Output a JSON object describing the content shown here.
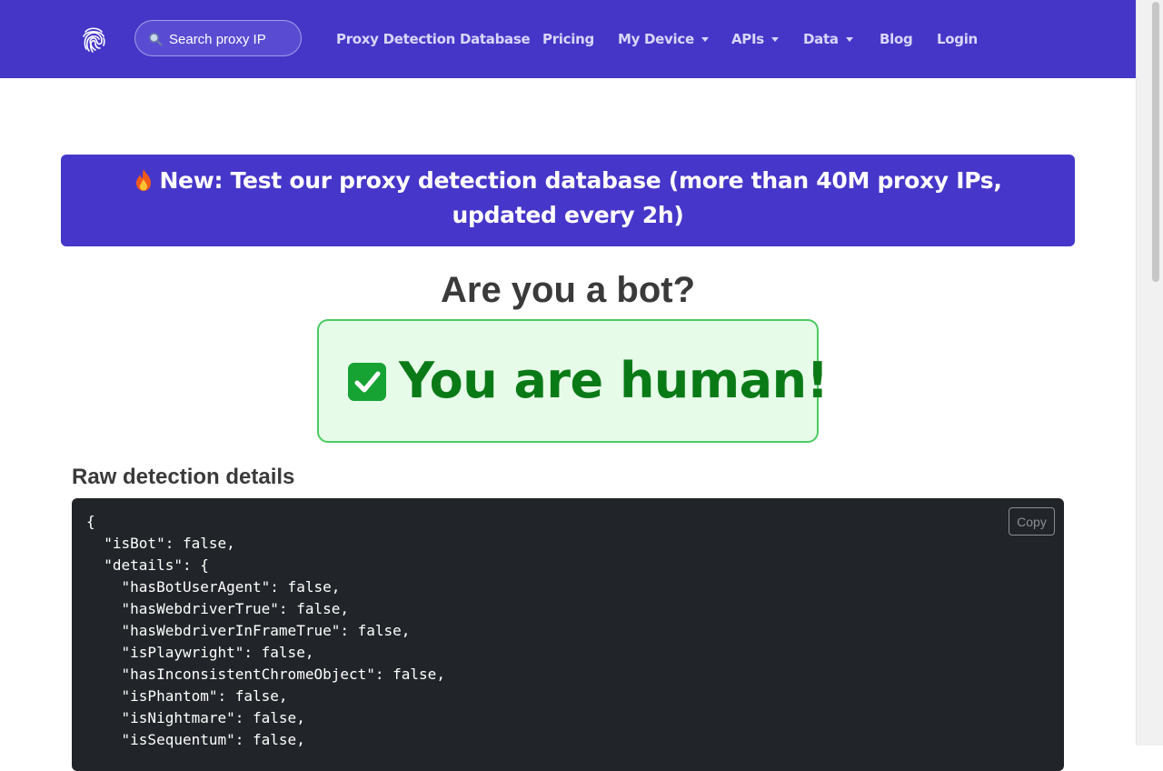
{
  "nav": {
    "search_placeholder": "Search proxy IP",
    "items": [
      {
        "label": "Proxy Detection Database",
        "dropdown": false
      },
      {
        "label": "Pricing",
        "dropdown": false
      },
      {
        "label": "My Device",
        "dropdown": true
      },
      {
        "label": "APIs",
        "dropdown": true
      },
      {
        "label": "Data",
        "dropdown": true
      },
      {
        "label": "Blog",
        "dropdown": false
      },
      {
        "label": "Login",
        "dropdown": false
      }
    ]
  },
  "banner": {
    "icon": "fire-icon",
    "text": "New: Test our proxy detection database (more than 40M proxy IPs, updated every 2h)"
  },
  "page": {
    "title": "Are you a bot?"
  },
  "result": {
    "icon": "check-box-icon",
    "text": "You are human!"
  },
  "raw": {
    "title": "Raw detection details",
    "copy_label": "Copy",
    "lines": [
      "{",
      "  \"isBot\": false,",
      "  \"details\": {",
      "    \"hasBotUserAgent\": false,",
      "    \"hasWebdriverTrue\": false,",
      "    \"hasWebdriverInFrameTrue\": false,",
      "    \"isPlaywright\": false,",
      "    \"hasInconsistentChromeObject\": false,",
      "    \"isPhantom\": false,",
      "    \"isNightmare\": false,",
      "    \"isSequentum\": false,"
    ]
  },
  "colors": {
    "nav_bg": "#4536c8",
    "banner_bg": "#4636c9",
    "success_text": "#0a7a16",
    "success_bg": "#e6fbe8",
    "success_border": "#4ccb62",
    "code_bg": "#212529"
  }
}
